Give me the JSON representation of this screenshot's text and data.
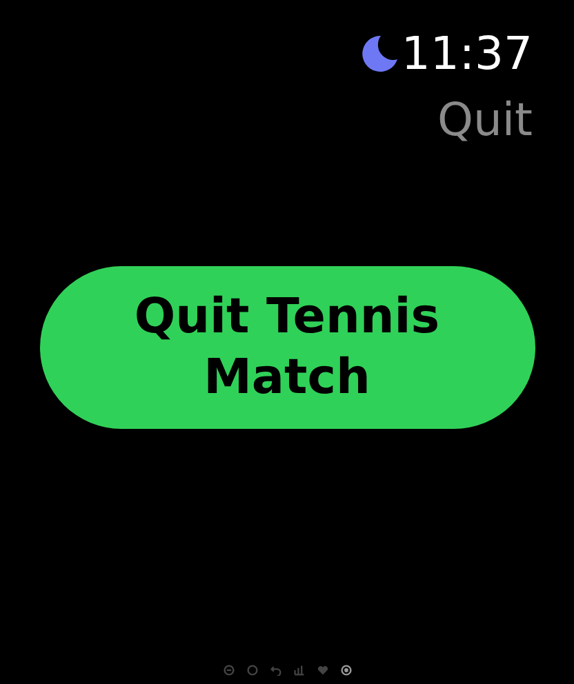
{
  "status": {
    "focus_on": true,
    "time": "11:37"
  },
  "title": "Quit",
  "button": {
    "label": "Quit Tennis Match"
  },
  "page_indicators": [
    {
      "kind": "circle",
      "selected": false
    },
    {
      "kind": "ring",
      "selected": false
    },
    {
      "kind": "undo",
      "selected": false
    },
    {
      "kind": "bars",
      "selected": false
    },
    {
      "kind": "heart",
      "selected": false
    },
    {
      "kind": "target",
      "selected": true
    }
  ]
}
